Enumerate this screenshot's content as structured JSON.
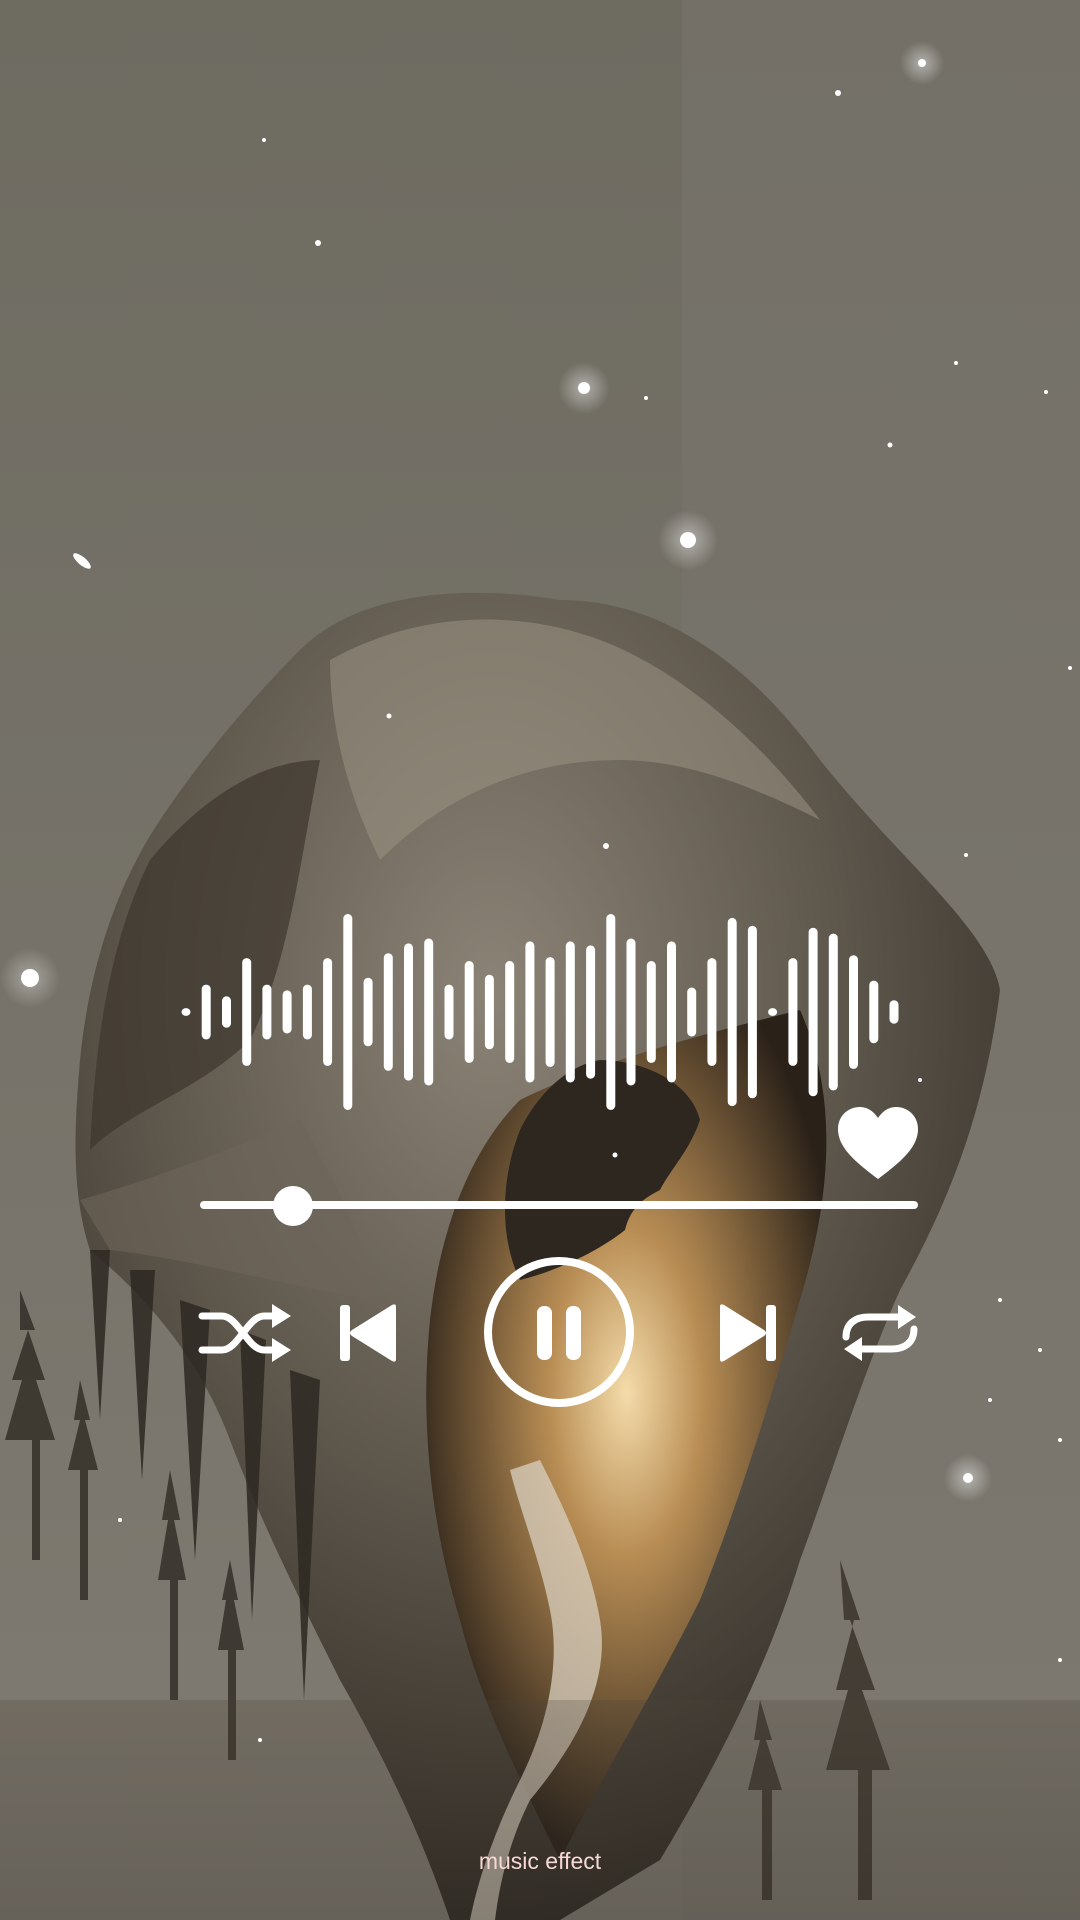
{
  "player": {
    "waveform_levels": [
      0.04,
      0.28,
      0.16,
      0.55,
      0.28,
      0.22,
      0.28,
      0.55,
      1.0,
      0.35,
      0.6,
      0.7,
      0.75,
      0.28,
      0.52,
      0.38,
      0.52,
      0.72,
      0.56,
      0.72,
      0.68,
      1.0,
      0.75,
      0.52,
      0.72,
      0.25,
      0.55,
      0.96,
      0.88,
      0.04,
      0.55,
      0.86,
      0.8,
      0.58,
      0.32,
      0.12
    ],
    "progress": 0.13,
    "state": "playing",
    "liked": true,
    "caption": "music effect",
    "colors": {
      "controls": "#ffffff",
      "background": "#6f6b61",
      "caption": "#f7d7d7"
    }
  },
  "icons": {
    "like": "heart-icon",
    "shuffle": "shuffle-icon",
    "previous": "skip-previous-icon",
    "pause": "pause-icon",
    "next": "skip-next-icon",
    "repeat": "repeat-icon"
  }
}
